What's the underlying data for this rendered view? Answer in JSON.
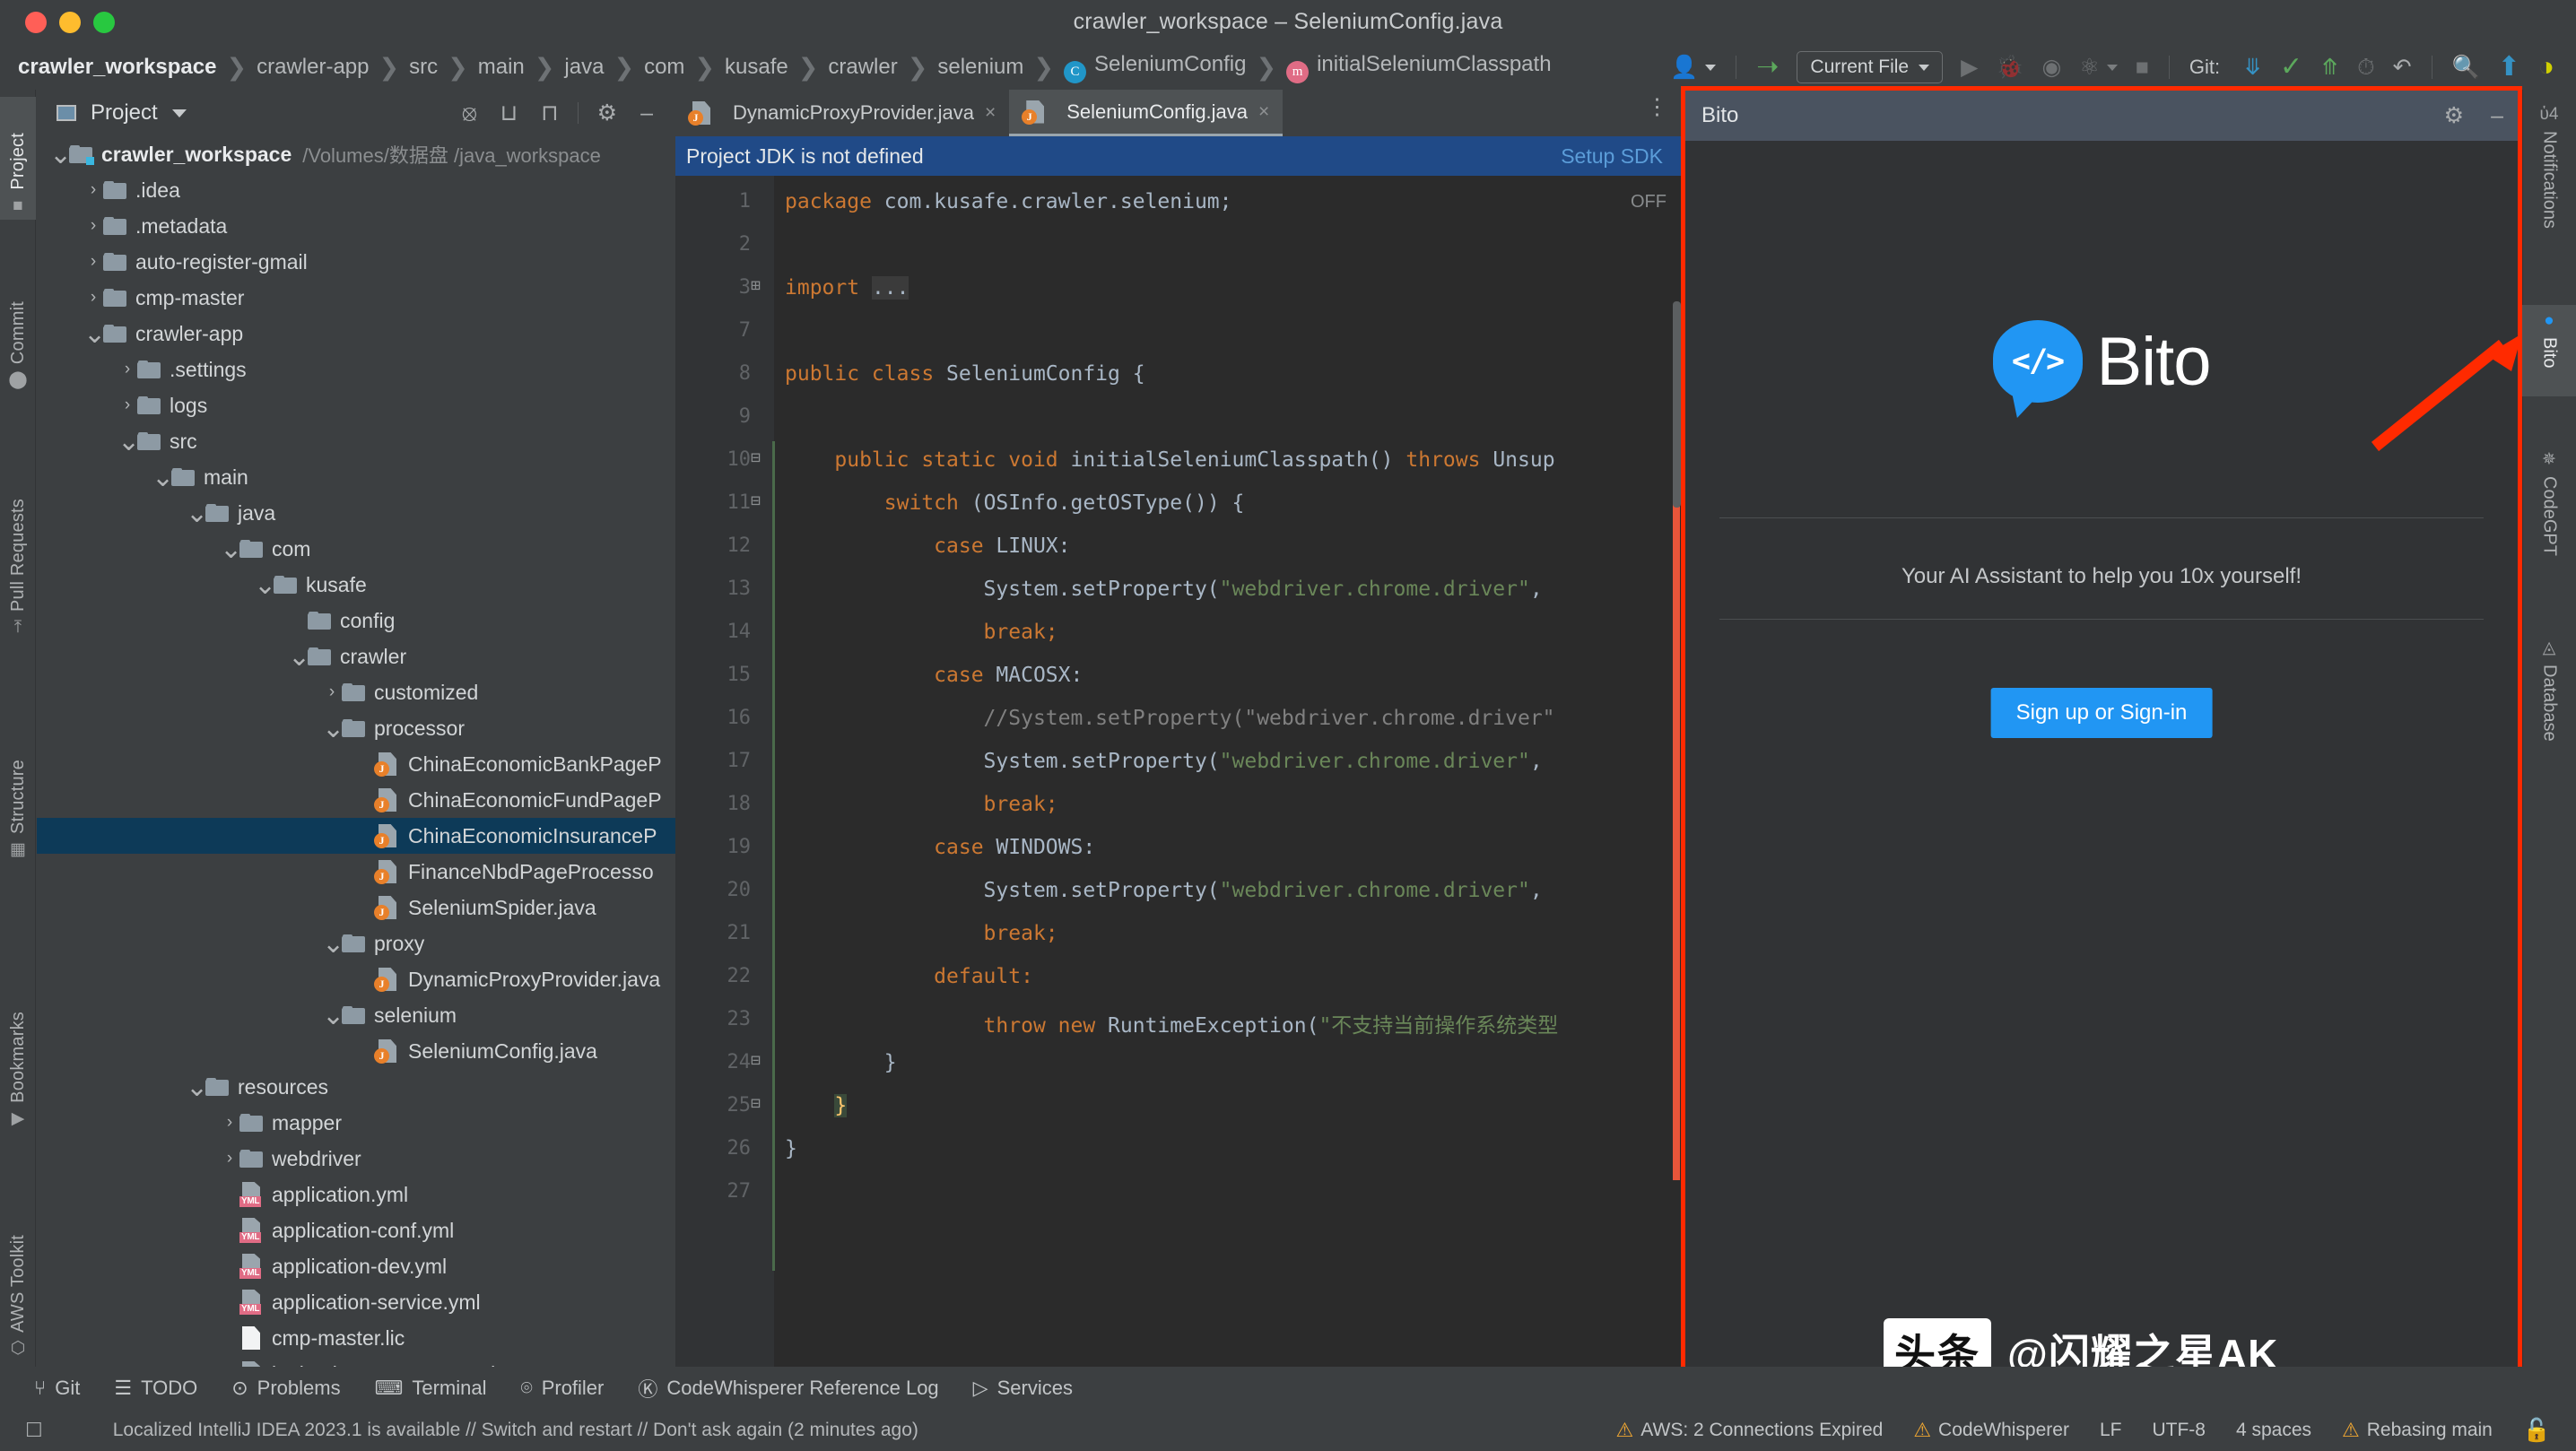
{
  "window": {
    "title": "crawler_workspace – SeleniumConfig.java",
    "traffic_lights": [
      "close",
      "minimize",
      "zoom"
    ]
  },
  "breadcrumb": [
    {
      "label": "crawler_workspace",
      "icon": null
    },
    {
      "label": "crawler-app",
      "icon": null
    },
    {
      "label": "src",
      "icon": null
    },
    {
      "label": "main",
      "icon": null
    },
    {
      "label": "java",
      "icon": null
    },
    {
      "label": "com",
      "icon": null
    },
    {
      "label": "kusafe",
      "icon": null
    },
    {
      "label": "crawler",
      "icon": null
    },
    {
      "label": "selenium",
      "icon": null
    },
    {
      "label": "SeleniumConfig",
      "icon": "class-icon",
      "icon_letter": "C"
    },
    {
      "label": "initialSeleniumClasspath",
      "icon": "method-icon",
      "icon_letter": "m"
    }
  ],
  "toolbar": {
    "user_icon": "user-avatar-icon",
    "build_icon": "hammer-icon",
    "run_config": "Current File",
    "run_icon": "run-triangle-icon",
    "debug_icon": "debug-bug-icon",
    "coverage_icon": "coverage-icon",
    "profile_icon": "profiler-icon",
    "stop_icon": "stop-square-icon",
    "git_label": "Git:",
    "git_update_icon": "update-project-icon",
    "git_commit_icon": "commit-check-icon",
    "git_push_icon": "push-arrow-icon",
    "history_icon": "history-clock-icon",
    "rollback_icon": "rollback-icon",
    "search_icon": "search-magnifier-icon",
    "upload_icon": "upload-circle-icon",
    "ui_icon": "theme-toggle-icon"
  },
  "left_strip": [
    {
      "label": "Project",
      "icon": "project-folder-icon",
      "active": true
    },
    {
      "label": "Commit",
      "icon": "commit-icon",
      "active": false
    },
    {
      "label": "Pull Requests",
      "icon": "pull-request-icon",
      "active": false
    },
    {
      "label": "Structure",
      "icon": "structure-icon",
      "active": false
    },
    {
      "label": "Bookmarks",
      "icon": "bookmark-icon",
      "active": false
    },
    {
      "label": "AWS Toolkit",
      "icon": "aws-icon",
      "active": false
    }
  ],
  "project_panel": {
    "title": "Project",
    "header_icons": [
      "locate-icon",
      "expand-all-icon",
      "collapse-all-icon",
      "gear-icon",
      "hide-icon"
    ],
    "tree": [
      {
        "indent": 0,
        "arrow": "v",
        "type": "module",
        "name": "crawler_workspace",
        "bold": true,
        "path": "/Volumes/数据盘 /java_workspace"
      },
      {
        "indent": 1,
        "arrow": ">",
        "type": "folder",
        "name": ".idea"
      },
      {
        "indent": 1,
        "arrow": ">",
        "type": "folder",
        "name": ".metadata"
      },
      {
        "indent": 1,
        "arrow": ">",
        "type": "folder",
        "name": "auto-register-gmail"
      },
      {
        "indent": 1,
        "arrow": ">",
        "type": "folder",
        "name": "cmp-master"
      },
      {
        "indent": 1,
        "arrow": "v",
        "type": "folder",
        "name": "crawler-app"
      },
      {
        "indent": 2,
        "arrow": ">",
        "type": "folder",
        "name": ".settings"
      },
      {
        "indent": 2,
        "arrow": ">",
        "type": "folder",
        "name": "logs"
      },
      {
        "indent": 2,
        "arrow": "v",
        "type": "folder",
        "name": "src"
      },
      {
        "indent": 3,
        "arrow": "v",
        "type": "folder",
        "name": "main"
      },
      {
        "indent": 4,
        "arrow": "v",
        "type": "folder",
        "name": "java"
      },
      {
        "indent": 5,
        "arrow": "v",
        "type": "folder",
        "name": "com"
      },
      {
        "indent": 6,
        "arrow": "v",
        "type": "folder",
        "name": "kusafe"
      },
      {
        "indent": 7,
        "arrow": "",
        "type": "folder",
        "name": "config"
      },
      {
        "indent": 7,
        "arrow": "v",
        "type": "folder",
        "name": "crawler"
      },
      {
        "indent": 8,
        "arrow": ">",
        "type": "folder",
        "name": "customized"
      },
      {
        "indent": 8,
        "arrow": "v",
        "type": "folder",
        "name": "processor"
      },
      {
        "indent": 9,
        "arrow": "",
        "type": "java",
        "name": "ChinaEconomicBankPageP"
      },
      {
        "indent": 9,
        "arrow": "",
        "type": "java",
        "name": "ChinaEconomicFundPageP"
      },
      {
        "indent": 9,
        "arrow": "",
        "type": "java",
        "name": "ChinaEconomicInsuranceP",
        "selected": true
      },
      {
        "indent": 9,
        "arrow": "",
        "type": "java",
        "name": "FinanceNbdPageProcesso"
      },
      {
        "indent": 9,
        "arrow": "",
        "type": "java",
        "name": "SeleniumSpider.java"
      },
      {
        "indent": 8,
        "arrow": "v",
        "type": "folder",
        "name": "proxy"
      },
      {
        "indent": 9,
        "arrow": "",
        "type": "java",
        "name": "DynamicProxyProvider.java"
      },
      {
        "indent": 8,
        "arrow": "v",
        "type": "folder",
        "name": "selenium"
      },
      {
        "indent": 9,
        "arrow": "",
        "type": "java",
        "name": "SeleniumConfig.java"
      },
      {
        "indent": 4,
        "arrow": "v",
        "type": "folder",
        "name": "resources"
      },
      {
        "indent": 5,
        "arrow": ">",
        "type": "folder",
        "name": "mapper"
      },
      {
        "indent": 5,
        "arrow": ">",
        "type": "folder",
        "name": "webdriver"
      },
      {
        "indent": 5,
        "arrow": "",
        "type": "yml",
        "name": "application.yml"
      },
      {
        "indent": 5,
        "arrow": "",
        "type": "yml",
        "name": "application-conf.yml"
      },
      {
        "indent": 5,
        "arrow": "",
        "type": "yml",
        "name": "application-dev.yml"
      },
      {
        "indent": 5,
        "arrow": "",
        "type": "yml",
        "name": "application-service.yml"
      },
      {
        "indent": 5,
        "arrow": "",
        "type": "lic",
        "name": "cmp-master.lic"
      },
      {
        "indent": 5,
        "arrow": "",
        "type": "xml",
        "name": "logback-cmp-master.xml"
      }
    ]
  },
  "editor": {
    "tabs": [
      {
        "label": "DynamicProxyProvider.java",
        "active": false,
        "close": "×"
      },
      {
        "label": "SeleniumConfig.java",
        "active": true,
        "close": "×"
      }
    ],
    "tab_menu_icon": "more-options-icon",
    "notification": {
      "message": "Project JDK is not defined",
      "action": "Setup SDK"
    },
    "off_label": "OFF",
    "lines": [
      {
        "num": "1",
        "fold": "",
        "segments": [
          {
            "t": "package ",
            "c": "kw"
          },
          {
            "t": "com.kusafe.crawler.selenium;",
            "c": "txt"
          }
        ]
      },
      {
        "num": "2",
        "fold": "",
        "segments": []
      },
      {
        "num": "3",
        "fold": "+",
        "segments": [
          {
            "t": "import ",
            "c": "kw"
          },
          {
            "t": "...",
            "c": "imp"
          }
        ]
      },
      {
        "num": "7",
        "fold": "",
        "segments": []
      },
      {
        "num": "8",
        "fold": "",
        "segments": [
          {
            "t": "public class ",
            "c": "kw"
          },
          {
            "t": "SeleniumConfig {",
            "c": "txt"
          }
        ]
      },
      {
        "num": "9",
        "fold": "",
        "segments": []
      },
      {
        "num": "10",
        "fold": "-",
        "segments": [
          {
            "t": "    public static void ",
            "c": "kw"
          },
          {
            "t": "initialSeleniumClasspath() ",
            "c": "txt"
          },
          {
            "t": "throws ",
            "c": "kw"
          },
          {
            "t": "Unsup",
            "c": "txt"
          }
        ]
      },
      {
        "num": "11",
        "fold": "-",
        "segments": [
          {
            "t": "        switch ",
            "c": "kw"
          },
          {
            "t": "(OSInfo.getOSType()) {",
            "c": "txt"
          }
        ]
      },
      {
        "num": "12",
        "fold": "",
        "segments": [
          {
            "t": "            case ",
            "c": "kw"
          },
          {
            "t": "LINUX:",
            "c": "txt"
          }
        ]
      },
      {
        "num": "13",
        "fold": "",
        "segments": [
          {
            "t": "                System.setProperty(",
            "c": "txt"
          },
          {
            "t": "\"webdriver.chrome.driver\"",
            "c": "str"
          },
          {
            "t": ",",
            "c": "txt"
          }
        ]
      },
      {
        "num": "14",
        "fold": "",
        "segments": [
          {
            "t": "                break;",
            "c": "kw"
          }
        ]
      },
      {
        "num": "15",
        "fold": "",
        "segments": [
          {
            "t": "            case ",
            "c": "kw"
          },
          {
            "t": "MACOSX:",
            "c": "txt"
          }
        ]
      },
      {
        "num": "16",
        "fold": "",
        "segments": [
          {
            "t": "                //System.setProperty(\"webdriver.chrome.driver\"",
            "c": "cmt"
          }
        ]
      },
      {
        "num": "17",
        "fold": "",
        "segments": [
          {
            "t": "                System.setProperty(",
            "c": "txt"
          },
          {
            "t": "\"webdriver.chrome.driver\"",
            "c": "str"
          },
          {
            "t": ",",
            "c": "txt"
          }
        ]
      },
      {
        "num": "18",
        "fold": "",
        "segments": [
          {
            "t": "                break;",
            "c": "kw"
          }
        ]
      },
      {
        "num": "19",
        "fold": "",
        "segments": [
          {
            "t": "            case ",
            "c": "kw"
          },
          {
            "t": "WINDOWS:",
            "c": "txt"
          }
        ]
      },
      {
        "num": "20",
        "fold": "",
        "segments": [
          {
            "t": "                System.setProperty(",
            "c": "txt"
          },
          {
            "t": "\"webdriver.chrome.driver\"",
            "c": "str"
          },
          {
            "t": ",",
            "c": "txt"
          }
        ]
      },
      {
        "num": "21",
        "fold": "",
        "segments": [
          {
            "t": "                break;",
            "c": "kw"
          }
        ]
      },
      {
        "num": "22",
        "fold": "",
        "segments": [
          {
            "t": "            default:",
            "c": "kw"
          }
        ]
      },
      {
        "num": "23",
        "fold": "",
        "segments": [
          {
            "t": "                throw new ",
            "c": "kw"
          },
          {
            "t": "RuntimeException(",
            "c": "txt"
          },
          {
            "t": "\"不支持当前操作系统类型",
            "c": "str"
          }
        ]
      },
      {
        "num": "24",
        "fold": "-",
        "segments": [
          {
            "t": "        }",
            "c": "txt"
          }
        ]
      },
      {
        "num": "25",
        "fold": "-",
        "segments": [
          {
            "t": "    ",
            "c": "txt"
          },
          {
            "t": "}",
            "c": "brace-hl"
          }
        ]
      },
      {
        "num": "26",
        "fold": "",
        "segments": [
          {
            "t": "}",
            "c": "txt"
          }
        ]
      },
      {
        "num": "27",
        "fold": "",
        "segments": []
      }
    ]
  },
  "bito": {
    "title": "Bito",
    "gear_icon": "gear-icon",
    "minimize_icon": "minimize-icon",
    "logo_word": "Bito",
    "logo_glyph": "</>",
    "tagline": "Your AI Assistant to help you 10x yourself!",
    "cta": "Sign up or Sign-in"
  },
  "right_strip": [
    {
      "label": "Notifications",
      "icon": "bell-icon",
      "active": false
    },
    {
      "label": "Bito",
      "icon": "bito-icon",
      "active": true
    },
    {
      "label": "CodeGPT",
      "icon": "codegpt-icon",
      "active": false
    },
    {
      "label": "Database",
      "icon": "database-icon",
      "active": false
    }
  ],
  "bottom_tools": [
    {
      "label": "Git",
      "icon": "git-branch-icon"
    },
    {
      "label": "TODO",
      "icon": "todo-list-icon"
    },
    {
      "label": "Problems",
      "icon": "problems-icon"
    },
    {
      "label": "Terminal",
      "icon": "terminal-icon"
    },
    {
      "label": "Profiler",
      "icon": "profiler-icon"
    },
    {
      "label": "CodeWhisperer Reference Log",
      "icon": "codewhisperer-icon"
    },
    {
      "label": "Services",
      "icon": "services-icon"
    }
  ],
  "status_bar": {
    "message": "Localized IntelliJ IDEA 2023.1 is available // Switch and restart // Don't ask again (2 minutes ago)",
    "message_icon": "ide-info-icon",
    "right": [
      {
        "label": "AWS: 2 Connections Expired",
        "warn": true
      },
      {
        "label": "CodeWhisperer",
        "warn": true
      },
      {
        "label": "LF",
        "warn": false
      },
      {
        "label": "UTF-8",
        "warn": false
      },
      {
        "label": "4 spaces",
        "warn": false
      },
      {
        "label": "Rebasing main",
        "warn": true
      }
    ],
    "lock_icon": "lock-icon"
  },
  "watermark": {
    "logo": "头条",
    "text": "@闪耀之星AK"
  },
  "colors": {
    "accent_blue": "#2196f3",
    "annotation_red": "#ff2a00",
    "sdk_bar": "#204a87",
    "selection": "#0d3a58",
    "editor_bg": "#2b2b2b",
    "panel_bg": "#3c3f41"
  }
}
